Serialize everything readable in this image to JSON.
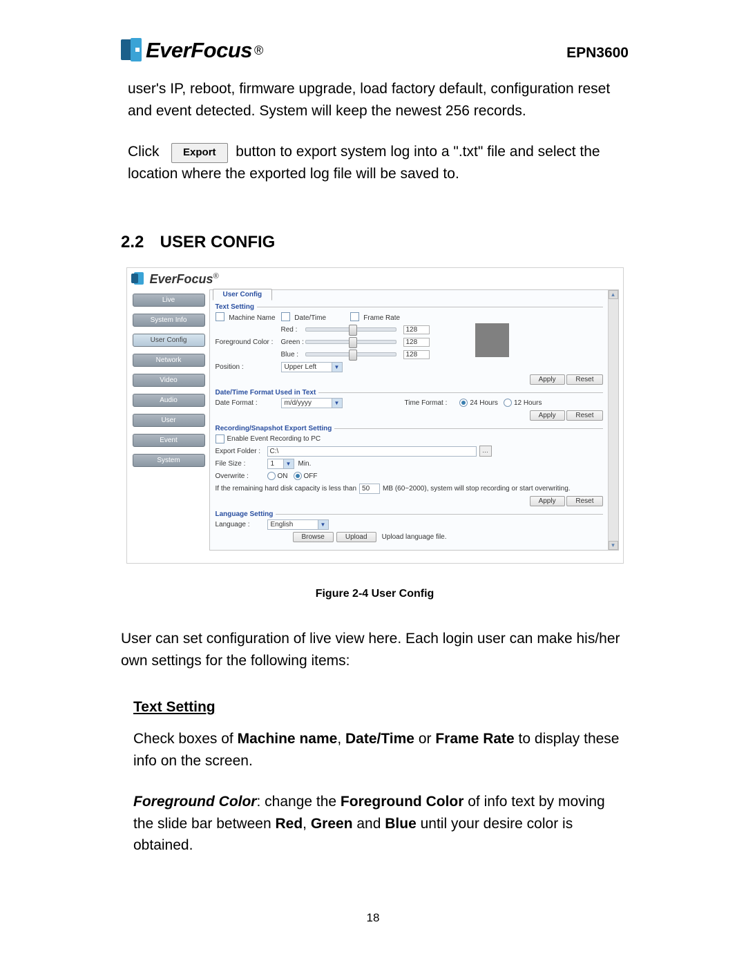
{
  "header": {
    "logo_text": "EverFocus",
    "reg": "®",
    "model": "EPN3600"
  },
  "intro1": "user's IP, reboot, firmware upgrade, load factory default, configuration reset and event detected. System will keep the newest 256 records.",
  "export_line": {
    "pre": "Click",
    "button": "Export",
    "post": " button to export system log into a \".txt\" file and select the location where the exported log file will be saved to."
  },
  "section": {
    "number": "2.2",
    "title": "USER CONFIG"
  },
  "figure": {
    "logo": "EverFocus",
    "reg": "®",
    "nav": [
      "Live",
      "System Info",
      "User Config",
      "Network",
      "Video",
      "Audio",
      "User",
      "Event",
      "System"
    ],
    "active_nav_index": 2,
    "tab": "User Config",
    "text_setting": {
      "legend": "Text Setting",
      "machine_name": "Machine Name",
      "date_time": "Date/Time",
      "frame_rate": "Frame Rate",
      "fg_color": "Foreground Color :",
      "red": "Red :",
      "green": "Green :",
      "blue": "Blue :",
      "rgb_value": "128",
      "position": "Position :",
      "position_val": "Upper Left",
      "apply": "Apply",
      "reset": "Reset"
    },
    "dt_format": {
      "legend": "Date/Time Format Used in Text",
      "date_format": "Date Format :",
      "date_val": "m/d/yyyy",
      "time_format": "Time Format :",
      "h24": "24 Hours",
      "h12": "12 Hours",
      "apply": "Apply",
      "reset": "Reset"
    },
    "rec": {
      "legend": "Recording/Snapshot Export Setting",
      "enable": "Enable Event Recording to PC",
      "export_folder": "Export Folder :",
      "export_val": "C:\\",
      "file_size": "File Size :",
      "file_val": "1",
      "file_unit": "Min.",
      "overwrite": "Overwrite :",
      "on": "ON",
      "off": "OFF",
      "warn_pre": "If the remaining hard disk capacity is less than",
      "warn_val": "50",
      "warn_post": "MB (60~2000), system will stop recording or start overwriting.",
      "apply": "Apply",
      "reset": "Reset"
    },
    "lang": {
      "legend": "Language Setting",
      "language": "Language :",
      "lang_val": "English",
      "browse": "Browse",
      "upload": "Upload",
      "note": "Upload language file."
    }
  },
  "caption": "Figure 2-4 User Config",
  "para_after": "User can set configuration of live view here. Each login user can make his/her own settings for the following items:",
  "sub_head": "Text Setting",
  "para_cb": {
    "pre": "Check boxes of ",
    "b1": "Machine name",
    "mid1": ", ",
    "b2": "Date/Time",
    "mid2": " or ",
    "b3": "Frame Rate",
    "post": " to display these info on the screen."
  },
  "para_fg": {
    "bi": "Foreground Color",
    "t1": ": change the ",
    "b1": "Foreground Color",
    "t2": " of info text by moving the slide bar between ",
    "b2": "Red",
    "t3": ", ",
    "b3": "Green",
    "t4": " and ",
    "b4": "Blue",
    "t5": " until your desire color is obtained."
  },
  "page_number": "18"
}
